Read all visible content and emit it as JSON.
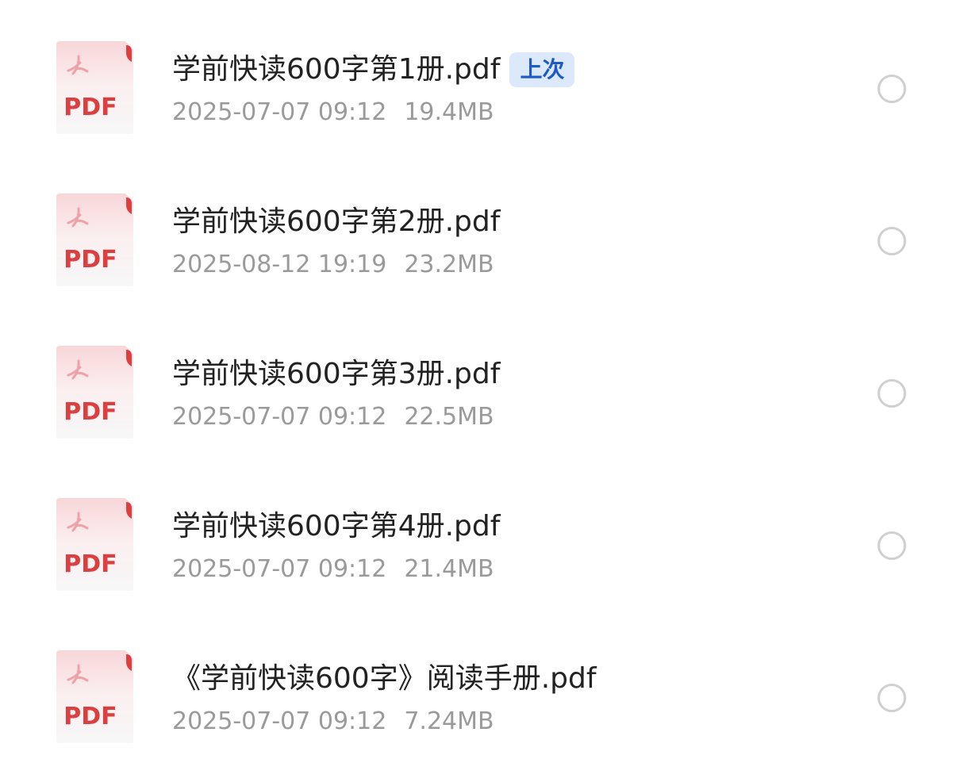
{
  "colors": {
    "pdf_red": "#db3f3f",
    "badge_bg": "#dce9fb",
    "badge_text": "#1c59c9",
    "meta_text": "#9a9a9a",
    "radio_border": "#cfcfcf"
  },
  "icons": {
    "file": "pdf-file-icon",
    "select": "radio-unchecked-icon"
  },
  "files": [
    {
      "icon_label": "PDF",
      "name": "学前快读600字第1册.pdf",
      "badge": "上次",
      "date": "2025-07-07 09:12",
      "size": "19.4MB"
    },
    {
      "icon_label": "PDF",
      "name": "学前快读600字第2册.pdf",
      "badge": "",
      "date": "2025-08-12 19:19",
      "size": "23.2MB"
    },
    {
      "icon_label": "PDF",
      "name": "学前快读600字第3册.pdf",
      "badge": "",
      "date": "2025-07-07 09:12",
      "size": "22.5MB"
    },
    {
      "icon_label": "PDF",
      "name": "学前快读600字第4册.pdf",
      "badge": "",
      "date": "2025-07-07 09:12",
      "size": "21.4MB"
    },
    {
      "icon_label": "PDF",
      "name": "《学前快读600字》阅读手册.pdf",
      "badge": "",
      "date": "2025-07-07 09:12",
      "size": "7.24MB"
    }
  ]
}
